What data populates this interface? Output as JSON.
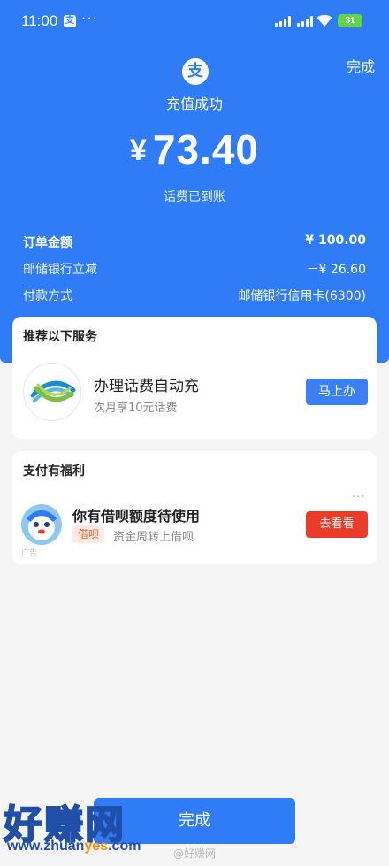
{
  "status_bar": {
    "time": "11:00",
    "app_icon_text": "支",
    "more_dots": "···",
    "battery": "31"
  },
  "header": {
    "done_label": "完成",
    "logo_char": "支",
    "success_text": "充值成功",
    "currency_symbol": "¥",
    "amount": "73.40",
    "credited_text": "话费已到账"
  },
  "details": [
    {
      "label": "订单金额",
      "value": "¥ 100.00"
    },
    {
      "label": "邮储银行立减",
      "value": "－¥ 26.60"
    },
    {
      "label": "付款方式",
      "value": "邮储银行信用卡(6300)"
    }
  ],
  "recommend_card": {
    "title": "推荐以下服务",
    "service_title": "办理话费自动充",
    "service_subtitle": "次月享10元话费",
    "button_label": "马上办"
  },
  "benefit_card": {
    "title": "支付有福利",
    "more_dots": "···",
    "item_title": "你有借呗额度待使用",
    "tag": "借呗",
    "item_subtitle": "资金周转上借呗",
    "ad_label": "广告",
    "button_label": "去看看"
  },
  "footer": {
    "done_label": "完成"
  },
  "watermark": {
    "big_text": "好赚网",
    "url_prefix": "www.zhuan",
    "url_highlight": "yes",
    "url_suffix": ".com",
    "weibo": "@好赚网"
  },
  "colors": {
    "primary_blue": "#2f7cf6",
    "button_red": "#ea3b2b",
    "tag_orange": "#f0642d",
    "battery_green": "#5fd44c"
  }
}
